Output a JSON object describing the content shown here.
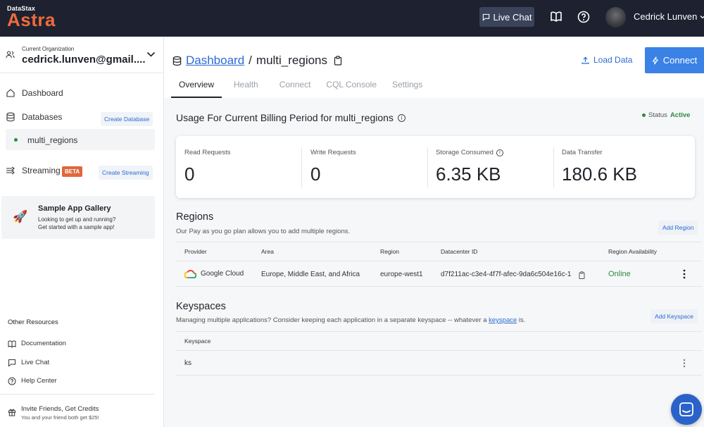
{
  "topbar": {
    "logo_small": "DataStax",
    "logo_big": "Astra",
    "live_chat_label": "Live Chat",
    "user_name": "Cedrick Lunven"
  },
  "sidebar": {
    "org_caption": "Current Organization",
    "org_email": "cedrick.lunven@gmail....",
    "dashboard_label": "Dashboard",
    "databases_label": "Databases",
    "create_database_label": "Create Database",
    "database_item": "multi_regions",
    "streaming_label": "Streaming",
    "beta_badge": "BETA",
    "create_streaming_label": "Create Streaming",
    "gallery_title": "Sample App Gallery",
    "gallery_line1": "Looking to get up and running?",
    "gallery_line2": "Get started with a sample app!",
    "other_resources": "Other Resources",
    "documentation": "Documentation",
    "live_chat": "Live Chat",
    "help_center": "Help Center",
    "invite_title": "Invite Friends, Get Credits",
    "invite_sub": "You and your friend both get $25!"
  },
  "header": {
    "crumb_root": "Dashboard",
    "crumb_sep": "/",
    "crumb_current": "multi_regions",
    "load_data_label": "Load Data",
    "connect_label": "Connect"
  },
  "tabs": [
    {
      "label": "Overview"
    },
    {
      "label": "Health"
    },
    {
      "label": "Connect"
    },
    {
      "label": "CQL Console"
    },
    {
      "label": "Settings"
    }
  ],
  "usage": {
    "title": "Usage For Current Billing Period for multi_regions",
    "status_label": "Status",
    "status_value": "Active",
    "stats": [
      {
        "label": "Read Requests",
        "value": "0"
      },
      {
        "label": "Write Requests",
        "value": "0"
      },
      {
        "label": "Storage Consumed",
        "value": "6.35 KB"
      },
      {
        "label": "Data Transfer",
        "value": "180.6 KB"
      }
    ]
  },
  "regions": {
    "title": "Regions",
    "subtitle": "Our Pay as you go plan allows you to add multiple regions.",
    "add_label": "Add Region",
    "columns": [
      "Provider",
      "Area",
      "Region",
      "Datacenter ID",
      "Region Availability"
    ],
    "rows": [
      {
        "provider": "Google Cloud",
        "area": "Europe, Middle East, and Africa",
        "region": "europe-west1",
        "datacenter_id": "d7f211ac-c3e4-4f7f-afec-9da6c504e16c-1",
        "availability": "Online"
      }
    ]
  },
  "keyspaces": {
    "title": "Keyspaces",
    "subtitle_before": "Managing multiple applications? Consider keeping each application in a separate keyspace -- whatever a ",
    "subtitle_link": "keyspace",
    "subtitle_after": " is.",
    "add_label": "Add Keyspace",
    "column": "Keyspace",
    "rows": [
      {
        "name": "ks"
      }
    ]
  },
  "colors": {
    "topbar_bg": "#1d2130",
    "brand_orange": "#ef6c3b",
    "accent_blue": "#3b82e6",
    "link_blue": "#2b6bd6",
    "online_green": "#2f8a3e"
  }
}
